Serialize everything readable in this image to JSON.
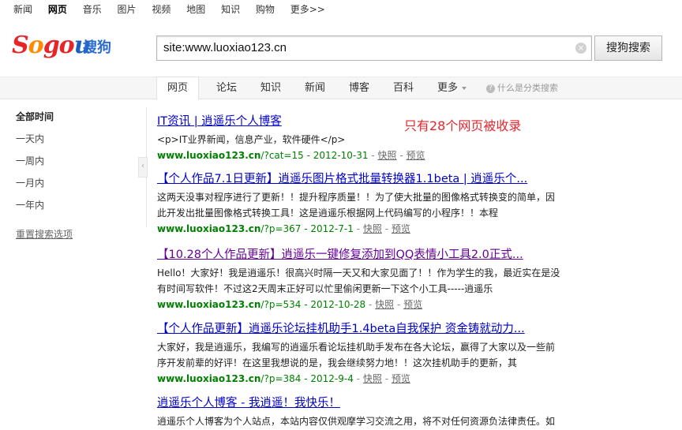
{
  "topnav": [
    "新闻",
    "网页",
    "音乐",
    "图片",
    "视频",
    "地图",
    "知识",
    "购物",
    "更多>>"
  ],
  "topnav_active_index": 1,
  "logo": {
    "latin": "Sogou",
    "cn": "搜狗"
  },
  "search": {
    "value": "site:www.luoxiao123.cn",
    "clear_symbol": "×",
    "button_label": "搜狗搜索"
  },
  "tabs": [
    "网页",
    "论坛",
    "知识",
    "新闻",
    "博客",
    "百科",
    "更多"
  ],
  "tabs_active_index": 0,
  "help_link": "什么是分类搜索",
  "sidebar": {
    "items": [
      "全部时间",
      "一天内",
      "一周内",
      "一月内",
      "一年内"
    ],
    "reset": "重置搜索选项"
  },
  "annotation": "只有28个网页被收录",
  "results": [
    {
      "title": "IT资讯 | 逍遥乐个人博客",
      "snippet": [
        "<p>IT业界新闻，信息产业，软件硬件</p>"
      ],
      "url_host": "www.luoxiao123.cn",
      "url_path": "/?cat=15 - 2012-10-31",
      "snapshot": "快照",
      "preview": "预览",
      "visited": false
    },
    {
      "title": "【个人作品7.1日更新】逍遥乐图片格式批量转换器1.1beta | 逍遥乐个...",
      "snippet": [
        "这两天没事对程序进行了更新！！提升程序质量！！为了使大批量的图像格式转换变的简单，因",
        "此开发出批量图像格式转换工具！这是逍遥乐根据网上代码编写的小程序！！本程"
      ],
      "url_host": "www.luoxiao123.cn",
      "url_path": "/?p=367 - 2012-7-1",
      "snapshot": "快照",
      "preview": "预览",
      "visited": false
    },
    {
      "title": "【10.28个人作品更新】逍遥乐一键修复添加到QQ表情小工具2.0正式...",
      "snippet": [
        "Hello！大家好！我是逍遥乐！很高兴时隔一天又和大家见面了！！作为学生的我，最近实在是没",
        "有时间写软件！不过这2天周末正好可以忙里偷闲更新一下这个小工具-----逍遥乐"
      ],
      "url_host": "www.luoxiao123.cn",
      "url_path": "/?p=534 - 2012-10-28",
      "snapshot": "快照",
      "preview": "预览",
      "visited": true
    },
    {
      "title": "【个人作品更新】逍遥乐论坛挂机助手1.4beta自我保护 资金铸就动力...",
      "snippet": [
        "大家好，我是逍遥乐，我编写的逍遥乐看论坛挂机助手发布在各大论坛，赢得了大家以及一些前",
        "序开发前辈的好评！在这里我想说的是，我会继续努力地！！这次挂机助手的更新，其"
      ],
      "url_host": "www.luoxiao123.cn",
      "url_path": "/?p=384 - 2012-9-4",
      "snapshot": "快照",
      "preview": "预览",
      "visited": false
    },
    {
      "title": "逍遥乐个人博客 - 我逍遥！我快乐！",
      "snippet": [
        "逍遥乐个人博客为个人站点，本站内容仅供观摩学习交流之用，将不对任何资源负法律责任。如"
      ],
      "url_host": "",
      "url_path": "",
      "snapshot": "",
      "preview": "",
      "visited": false
    }
  ]
}
